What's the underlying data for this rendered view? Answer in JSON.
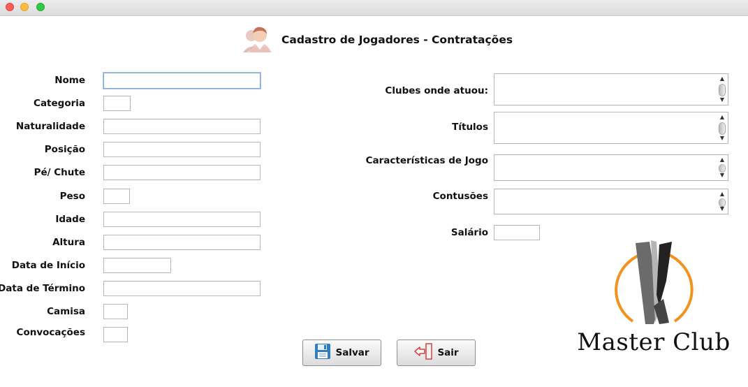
{
  "window": {
    "title": "Cadastro de Jogadores - Contratações"
  },
  "header": {
    "title": "Cadastro de Jogadores - Contratações",
    "icon": "player-avatar-icon"
  },
  "left_form": {
    "nome": {
      "label": "Nome",
      "value": ""
    },
    "categoria": {
      "label": "Categoria",
      "value": ""
    },
    "naturalidade": {
      "label": "Naturalidade",
      "value": ""
    },
    "posicao": {
      "label": "Posição",
      "value": ""
    },
    "pe_chute": {
      "label": "Pé/ Chute",
      "value": ""
    },
    "peso": {
      "label": "Peso",
      "value": ""
    },
    "idade": {
      "label": "Idade",
      "value": ""
    },
    "altura": {
      "label": "Altura",
      "value": ""
    },
    "data_inicio": {
      "label": "Data de Início",
      "value": ""
    },
    "data_termino": {
      "label": "Data de Término",
      "value": ""
    },
    "camisa": {
      "label": "Camisa",
      "value": ""
    },
    "convocacoes": {
      "label": "Convocações",
      "value": ""
    }
  },
  "right_form": {
    "clubes": {
      "label": "Clubes onde atuou:",
      "value": ""
    },
    "titulos": {
      "label": "Títulos",
      "value": ""
    },
    "caracteristicas": {
      "label": "Características de Jogo",
      "value": ""
    },
    "contusoes": {
      "label": "Contusões",
      "value": ""
    },
    "salario": {
      "label": "Salário",
      "value": ""
    }
  },
  "buttons": {
    "salvar": {
      "label": "Salvar",
      "icon": "floppy-disk-icon"
    },
    "sair": {
      "label": "Sair",
      "icon": "exit-door-icon"
    }
  },
  "logo": {
    "text": "Master Club",
    "accent_color": "#f0931f"
  },
  "colors": {
    "focus_border": "#7ea6d9",
    "field_border": "#b7b7b7"
  }
}
